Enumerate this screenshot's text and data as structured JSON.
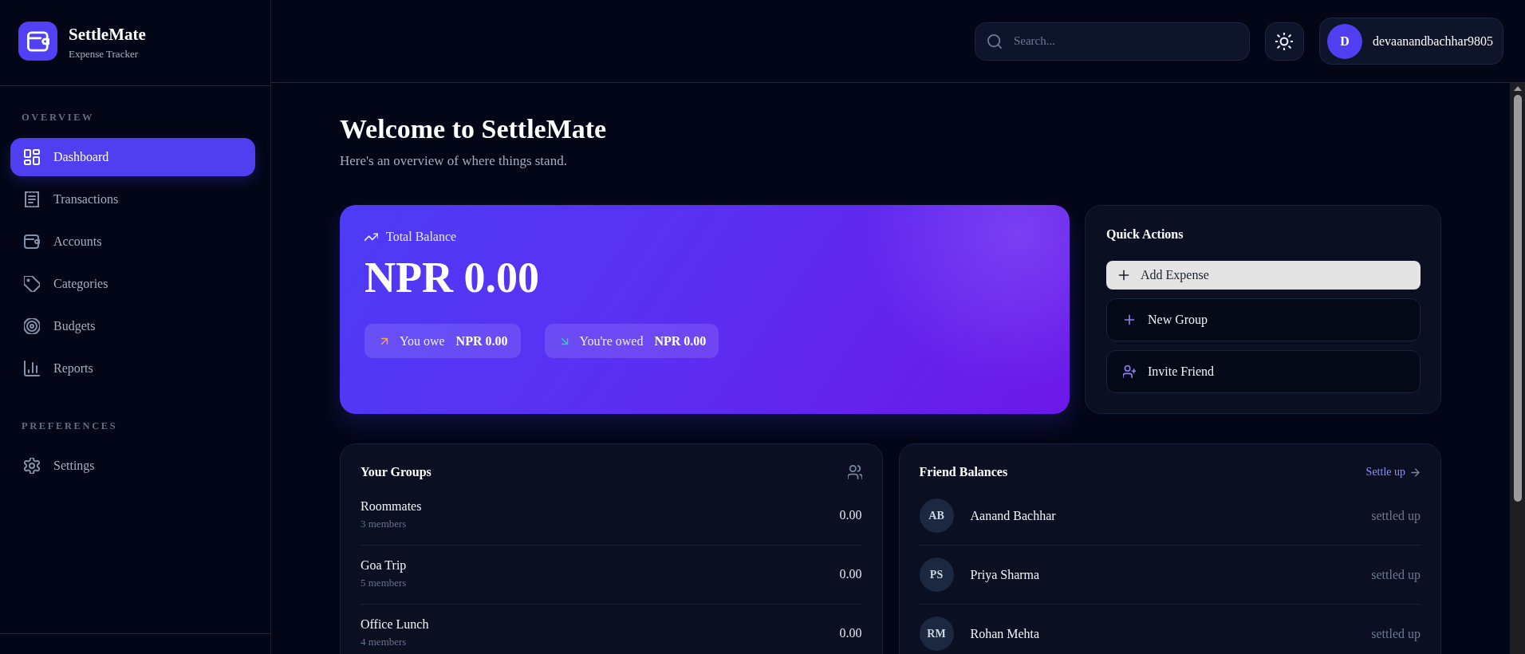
{
  "sidebar": {
    "brand": {
      "title": "SettleMate",
      "subtitle": "Expense Tracker"
    },
    "sections": [
      {
        "heading": "OVERVIEW",
        "items": [
          {
            "label": "Dashboard",
            "selected": true
          },
          {
            "label": "Transactions",
            "selected": false
          },
          {
            "label": "Accounts",
            "selected": false
          },
          {
            "label": "Categories",
            "selected": false
          },
          {
            "label": "Budgets",
            "selected": false
          },
          {
            "label": "Reports",
            "selected": false
          }
        ]
      },
      {
        "heading": "PREFERENCES",
        "items": [
          {
            "label": "Settings",
            "selected": false
          }
        ]
      }
    ]
  },
  "header": {
    "search": {
      "placeholder": "Search..."
    },
    "user": {
      "initial": "D",
      "name": "devaanandbachhar9805"
    }
  },
  "page": {
    "title": "Welcome to SettleMate",
    "subtitle": "Here's an overview of where things stand."
  },
  "balance_card": {
    "label": "Total Balance",
    "amount": "NPR 0.00",
    "pills": [
      {
        "kind": "owe",
        "label": "You owe",
        "amount": "NPR 0.00"
      },
      {
        "kind": "owed",
        "label": "You're owed",
        "amount": "NPR 0.00"
      }
    ]
  },
  "quick_actions": {
    "title": "Quick Actions",
    "buttons": [
      {
        "kind": "primary",
        "label": "Add Expense"
      },
      {
        "kind": "outline",
        "label": "New Group"
      },
      {
        "kind": "outline",
        "label": "Invite Friend"
      }
    ]
  },
  "groups": {
    "title": "Your Groups",
    "rows": [
      {
        "name": "Roommates",
        "members": "3 members",
        "amount": "0.00"
      },
      {
        "name": "Goa Trip",
        "members": "5 members",
        "amount": "0.00"
      },
      {
        "name": "Office Lunch",
        "members": "4 members",
        "amount": "0.00"
      }
    ]
  },
  "friend_balances": {
    "title": "Friend Balances",
    "link": "Settle up",
    "rows": [
      {
        "initials": "AB",
        "name": "Aanand Bachhar",
        "status": "settled up"
      },
      {
        "initials": "PS",
        "name": "Priya Sharma",
        "status": "settled up"
      },
      {
        "initials": "RM",
        "name": "Rohan Mehta",
        "status": "settled up"
      }
    ]
  }
}
